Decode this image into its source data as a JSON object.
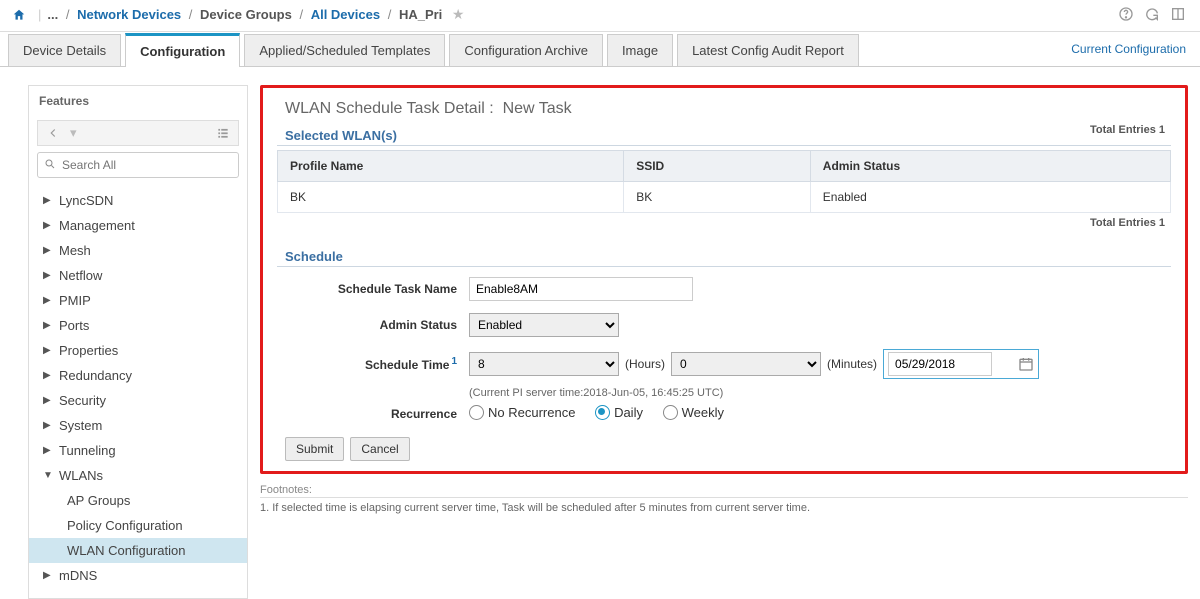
{
  "breadcrumb": {
    "ellipsis": "...",
    "links": [
      "Network Devices",
      "Device Groups",
      "All Devices"
    ],
    "current": "HA_Pri"
  },
  "tabs": {
    "items": [
      "Device Details",
      "Configuration",
      "Applied/Scheduled Templates",
      "Configuration Archive",
      "Image",
      "Latest Config Audit Report"
    ],
    "right_link": "Current Configuration",
    "active_index": 1
  },
  "sidebar": {
    "title": "Features",
    "search_placeholder": "Search All",
    "items": [
      "LyncSDN",
      "Management",
      "Mesh",
      "Netflow",
      "PMIP",
      "Ports",
      "Properties",
      "Redundancy",
      "Security",
      "System",
      "Tunneling",
      "WLANs",
      "mDNS"
    ],
    "wlan_children": [
      "AP Groups",
      "Policy Configuration",
      "WLAN Configuration"
    ],
    "selected_child_index": 2
  },
  "page": {
    "title_prefix": "WLAN Schedule Task Detail :",
    "title_value": "New Task"
  },
  "selected_wlans": {
    "heading": "Selected WLAN(s)",
    "total_label": "Total Entries 1",
    "columns": [
      "Profile Name",
      "SSID",
      "Admin Status"
    ],
    "row": {
      "profile": "BK",
      "ssid": "BK",
      "status": "Enabled"
    }
  },
  "schedule": {
    "heading": "Schedule",
    "labels": {
      "task_name": "Schedule Task Name",
      "admin_status": "Admin Status",
      "schedule_time": "Schedule Time",
      "recurrence": "Recurrence",
      "hours": "(Hours)",
      "minutes": "(Minutes)"
    },
    "task_name_value": "Enable8AM",
    "admin_status_value": "Enabled",
    "hours_value": "8",
    "minutes_value": "0",
    "date_value": "05/29/2018",
    "server_time_hint": "(Current PI server time:2018-Jun-05, 16:45:25 UTC)",
    "recurrence_options": [
      "No Recurrence",
      "Daily",
      "Weekly"
    ],
    "recurrence_selected": 1
  },
  "buttons": {
    "submit": "Submit",
    "cancel": "Cancel"
  },
  "footnotes": {
    "heading": "Footnotes:",
    "line": "1. If selected time is elapsing current server time, Task will be scheduled after 5 minutes from current server time."
  }
}
